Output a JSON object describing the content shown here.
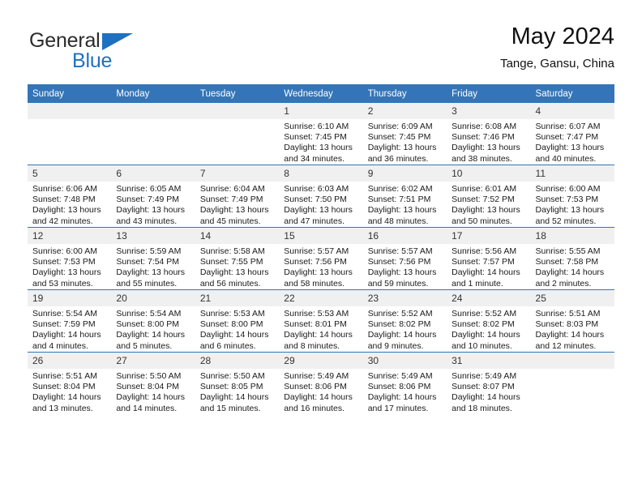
{
  "brand": {
    "name_part1": "General",
    "name_part2": "Blue",
    "triangle_color": "#1f70c1"
  },
  "header": {
    "title": "May 2024",
    "subtitle": "Tange, Gansu, China"
  },
  "theme": {
    "header_bar_color": "#3375b8",
    "daynum_bg": "#f0f0f0",
    "text_color": "#1a1a1a"
  },
  "weekday_headers": [
    "Sunday",
    "Monday",
    "Tuesday",
    "Wednesday",
    "Thursday",
    "Friday",
    "Saturday"
  ],
  "labels": {
    "sunrise_prefix": "Sunrise:",
    "sunset_prefix": "Sunset:",
    "daylight_prefix": "Daylight:"
  },
  "weeks": [
    [
      {
        "day": "",
        "sunrise": "",
        "sunset": "",
        "daylight_line1": "",
        "daylight_line2": "",
        "empty": true
      },
      {
        "day": "",
        "sunrise": "",
        "sunset": "",
        "daylight_line1": "",
        "daylight_line2": "",
        "empty": true
      },
      {
        "day": "",
        "sunrise": "",
        "sunset": "",
        "daylight_line1": "",
        "daylight_line2": "",
        "empty": true
      },
      {
        "day": "1",
        "sunrise": "Sunrise: 6:10 AM",
        "sunset": "Sunset: 7:45 PM",
        "daylight_line1": "Daylight: 13 hours",
        "daylight_line2": "and 34 minutes."
      },
      {
        "day": "2",
        "sunrise": "Sunrise: 6:09 AM",
        "sunset": "Sunset: 7:45 PM",
        "daylight_line1": "Daylight: 13 hours",
        "daylight_line2": "and 36 minutes."
      },
      {
        "day": "3",
        "sunrise": "Sunrise: 6:08 AM",
        "sunset": "Sunset: 7:46 PM",
        "daylight_line1": "Daylight: 13 hours",
        "daylight_line2": "and 38 minutes."
      },
      {
        "day": "4",
        "sunrise": "Sunrise: 6:07 AM",
        "sunset": "Sunset: 7:47 PM",
        "daylight_line1": "Daylight: 13 hours",
        "daylight_line2": "and 40 minutes."
      }
    ],
    [
      {
        "day": "5",
        "sunrise": "Sunrise: 6:06 AM",
        "sunset": "Sunset: 7:48 PM",
        "daylight_line1": "Daylight: 13 hours",
        "daylight_line2": "and 42 minutes."
      },
      {
        "day": "6",
        "sunrise": "Sunrise: 6:05 AM",
        "sunset": "Sunset: 7:49 PM",
        "daylight_line1": "Daylight: 13 hours",
        "daylight_line2": "and 43 minutes."
      },
      {
        "day": "7",
        "sunrise": "Sunrise: 6:04 AM",
        "sunset": "Sunset: 7:49 PM",
        "daylight_line1": "Daylight: 13 hours",
        "daylight_line2": "and 45 minutes."
      },
      {
        "day": "8",
        "sunrise": "Sunrise: 6:03 AM",
        "sunset": "Sunset: 7:50 PM",
        "daylight_line1": "Daylight: 13 hours",
        "daylight_line2": "and 47 minutes."
      },
      {
        "day": "9",
        "sunrise": "Sunrise: 6:02 AM",
        "sunset": "Sunset: 7:51 PM",
        "daylight_line1": "Daylight: 13 hours",
        "daylight_line2": "and 48 minutes."
      },
      {
        "day": "10",
        "sunrise": "Sunrise: 6:01 AM",
        "sunset": "Sunset: 7:52 PM",
        "daylight_line1": "Daylight: 13 hours",
        "daylight_line2": "and 50 minutes."
      },
      {
        "day": "11",
        "sunrise": "Sunrise: 6:00 AM",
        "sunset": "Sunset: 7:53 PM",
        "daylight_line1": "Daylight: 13 hours",
        "daylight_line2": "and 52 minutes."
      }
    ],
    [
      {
        "day": "12",
        "sunrise": "Sunrise: 6:00 AM",
        "sunset": "Sunset: 7:53 PM",
        "daylight_line1": "Daylight: 13 hours",
        "daylight_line2": "and 53 minutes."
      },
      {
        "day": "13",
        "sunrise": "Sunrise: 5:59 AM",
        "sunset": "Sunset: 7:54 PM",
        "daylight_line1": "Daylight: 13 hours",
        "daylight_line2": "and 55 minutes."
      },
      {
        "day": "14",
        "sunrise": "Sunrise: 5:58 AM",
        "sunset": "Sunset: 7:55 PM",
        "daylight_line1": "Daylight: 13 hours",
        "daylight_line2": "and 56 minutes."
      },
      {
        "day": "15",
        "sunrise": "Sunrise: 5:57 AM",
        "sunset": "Sunset: 7:56 PM",
        "daylight_line1": "Daylight: 13 hours",
        "daylight_line2": "and 58 minutes."
      },
      {
        "day": "16",
        "sunrise": "Sunrise: 5:57 AM",
        "sunset": "Sunset: 7:56 PM",
        "daylight_line1": "Daylight: 13 hours",
        "daylight_line2": "and 59 minutes."
      },
      {
        "day": "17",
        "sunrise": "Sunrise: 5:56 AM",
        "sunset": "Sunset: 7:57 PM",
        "daylight_line1": "Daylight: 14 hours",
        "daylight_line2": "and 1 minute."
      },
      {
        "day": "18",
        "sunrise": "Sunrise: 5:55 AM",
        "sunset": "Sunset: 7:58 PM",
        "daylight_line1": "Daylight: 14 hours",
        "daylight_line2": "and 2 minutes."
      }
    ],
    [
      {
        "day": "19",
        "sunrise": "Sunrise: 5:54 AM",
        "sunset": "Sunset: 7:59 PM",
        "daylight_line1": "Daylight: 14 hours",
        "daylight_line2": "and 4 minutes."
      },
      {
        "day": "20",
        "sunrise": "Sunrise: 5:54 AM",
        "sunset": "Sunset: 8:00 PM",
        "daylight_line1": "Daylight: 14 hours",
        "daylight_line2": "and 5 minutes."
      },
      {
        "day": "21",
        "sunrise": "Sunrise: 5:53 AM",
        "sunset": "Sunset: 8:00 PM",
        "daylight_line1": "Daylight: 14 hours",
        "daylight_line2": "and 6 minutes."
      },
      {
        "day": "22",
        "sunrise": "Sunrise: 5:53 AM",
        "sunset": "Sunset: 8:01 PM",
        "daylight_line1": "Daylight: 14 hours",
        "daylight_line2": "and 8 minutes."
      },
      {
        "day": "23",
        "sunrise": "Sunrise: 5:52 AM",
        "sunset": "Sunset: 8:02 PM",
        "daylight_line1": "Daylight: 14 hours",
        "daylight_line2": "and 9 minutes."
      },
      {
        "day": "24",
        "sunrise": "Sunrise: 5:52 AM",
        "sunset": "Sunset: 8:02 PM",
        "daylight_line1": "Daylight: 14 hours",
        "daylight_line2": "and 10 minutes."
      },
      {
        "day": "25",
        "sunrise": "Sunrise: 5:51 AM",
        "sunset": "Sunset: 8:03 PM",
        "daylight_line1": "Daylight: 14 hours",
        "daylight_line2": "and 12 minutes."
      }
    ],
    [
      {
        "day": "26",
        "sunrise": "Sunrise: 5:51 AM",
        "sunset": "Sunset: 8:04 PM",
        "daylight_line1": "Daylight: 14 hours",
        "daylight_line2": "and 13 minutes."
      },
      {
        "day": "27",
        "sunrise": "Sunrise: 5:50 AM",
        "sunset": "Sunset: 8:04 PM",
        "daylight_line1": "Daylight: 14 hours",
        "daylight_line2": "and 14 minutes."
      },
      {
        "day": "28",
        "sunrise": "Sunrise: 5:50 AM",
        "sunset": "Sunset: 8:05 PM",
        "daylight_line1": "Daylight: 14 hours",
        "daylight_line2": "and 15 minutes."
      },
      {
        "day": "29",
        "sunrise": "Sunrise: 5:49 AM",
        "sunset": "Sunset: 8:06 PM",
        "daylight_line1": "Daylight: 14 hours",
        "daylight_line2": "and 16 minutes."
      },
      {
        "day": "30",
        "sunrise": "Sunrise: 5:49 AM",
        "sunset": "Sunset: 8:06 PM",
        "daylight_line1": "Daylight: 14 hours",
        "daylight_line2": "and 17 minutes."
      },
      {
        "day": "31",
        "sunrise": "Sunrise: 5:49 AM",
        "sunset": "Sunset: 8:07 PM",
        "daylight_line1": "Daylight: 14 hours",
        "daylight_line2": "and 18 minutes."
      },
      {
        "day": "",
        "sunrise": "",
        "sunset": "",
        "daylight_line1": "",
        "daylight_line2": "",
        "empty": true
      }
    ]
  ]
}
